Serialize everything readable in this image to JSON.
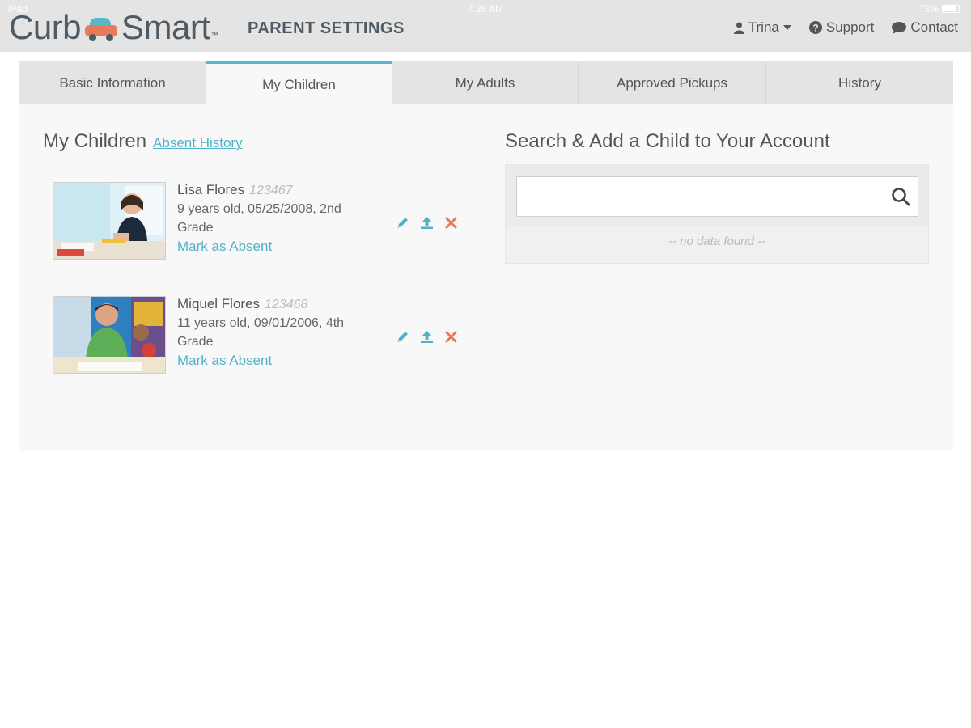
{
  "status_bar": {
    "device": "iPad",
    "time": "7:26 AM",
    "battery": "78%"
  },
  "header": {
    "logo_part1": "Curb",
    "logo_part2": "Smart",
    "logo_tm": "™",
    "page_title": "PARENT SETTINGS",
    "nav": {
      "user": "Trina",
      "support": "Support",
      "contact": "Contact"
    }
  },
  "tabs": [
    {
      "label": "Basic Information",
      "active": false
    },
    {
      "label": "My Children",
      "active": true
    },
    {
      "label": "My Adults",
      "active": false
    },
    {
      "label": "Approved Pickups",
      "active": false
    },
    {
      "label": "History",
      "active": false
    }
  ],
  "my_children": {
    "heading": "My Children",
    "absent_history_link": "Absent History",
    "children": [
      {
        "name": "Lisa Flores",
        "id": "123467",
        "details": "9 years old, 05/25/2008, 2nd Grade",
        "mark_absent": "Mark as Absent"
      },
      {
        "name": "Miquel Flores",
        "id": "123468",
        "details": "11 years old, 09/01/2006, 4th Grade",
        "mark_absent": "Mark as Absent"
      }
    ]
  },
  "search_child": {
    "heading": "Search & Add a Child to Your Account",
    "input_value": "",
    "no_data": "-- no data found --"
  },
  "colors": {
    "accent": "#55b8cc",
    "delete": "#e8795d",
    "header_bg": "#e4e4e4"
  },
  "icons": {
    "edit": "pencil-icon",
    "upload": "upload-icon",
    "remove": "close-icon",
    "search": "search-icon",
    "user": "user-icon",
    "support": "question-circle-icon",
    "contact": "chat-bubble-icon"
  }
}
